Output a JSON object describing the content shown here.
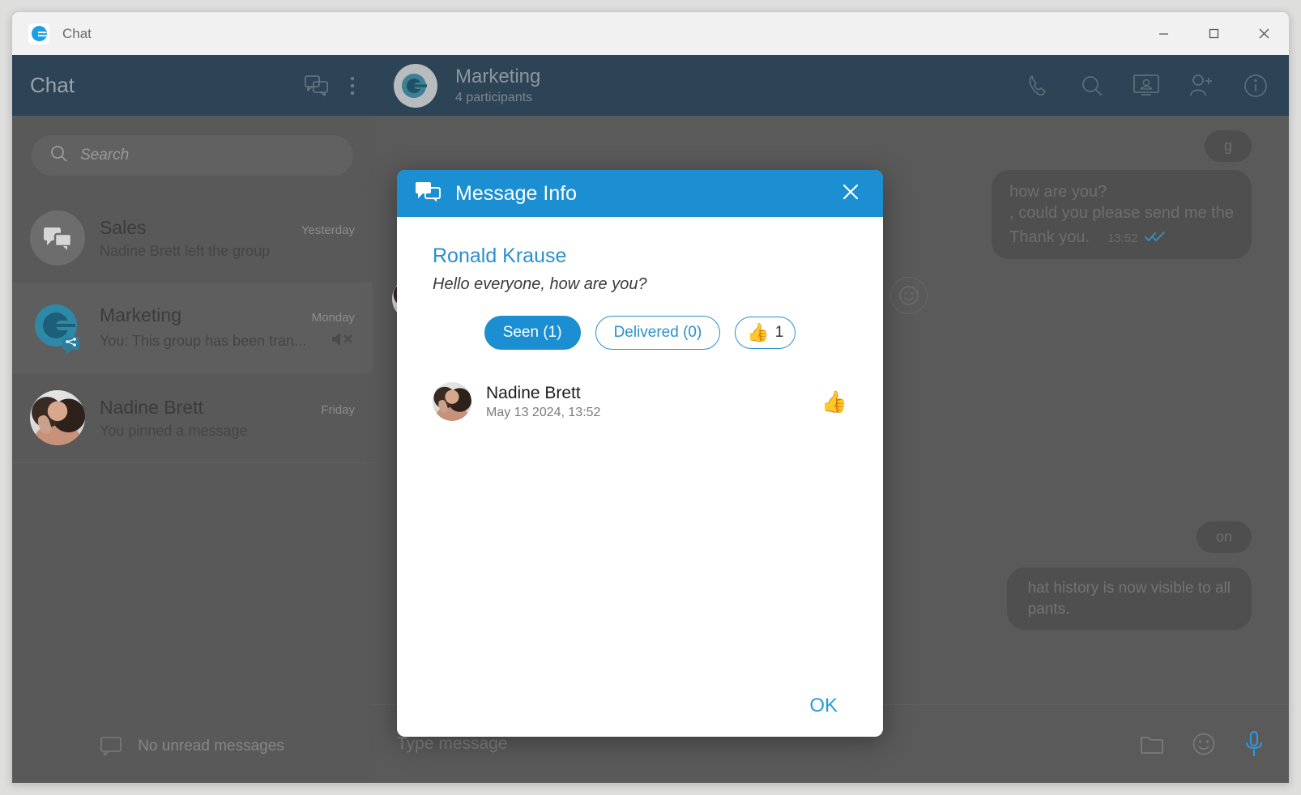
{
  "window": {
    "title": "Chat",
    "app_icon": "chat-app-logo-icon",
    "controls": {
      "minimize": "—",
      "maximize": "□",
      "close": "✕"
    }
  },
  "sidebar": {
    "title": "Chat",
    "new_chat_icon": "new-chat-icon",
    "menu_icon": "more-options-icon",
    "search": {
      "placeholder": "Search",
      "value": "",
      "icon": "search-icon"
    },
    "chats": [
      {
        "name": "Sales",
        "time": "Yesterday",
        "preview": "Nadine Brett left the group",
        "avatar": "group-chat-icon",
        "selected": false,
        "muted": false
      },
      {
        "name": "Marketing",
        "time": "Monday",
        "preview": "You: This group has been tran...",
        "avatar": "marketing-group-logo",
        "selected": true,
        "muted": true,
        "mute_icon": "muted-speaker-icon"
      },
      {
        "name": "Nadine Brett",
        "time": "Friday",
        "preview": "You pinned a message",
        "avatar": "nadine-brett-photo",
        "selected": false,
        "muted": false
      }
    ],
    "footer": {
      "label": "No unread messages",
      "icon": "speech-bubble-icon"
    }
  },
  "chat_header": {
    "title": "Marketing",
    "subtitle": "4 participants",
    "avatar": "marketing-group-logo",
    "actions": [
      {
        "name": "call-icon",
        "label": "Call"
      },
      {
        "name": "search-icon",
        "label": "Search"
      },
      {
        "name": "screen-share-icon",
        "label": "Screen share"
      },
      {
        "name": "add-participant-icon",
        "label": "Add participant"
      },
      {
        "name": "info-icon",
        "label": "Info"
      }
    ]
  },
  "conversation": {
    "messages": [
      {
        "type": "reaction-chip",
        "text": "g"
      },
      {
        "type": "outgoing",
        "text_lines": [
          "how are you?",
          ", could you please send me the",
          "Thank you."
        ],
        "time": "13:52",
        "status_icon": "double-check-icon"
      },
      {
        "type": "add-reaction",
        "icon": "smiley-icon"
      },
      {
        "type": "system",
        "text": "on"
      },
      {
        "type": "notice",
        "text_lines": [
          "hat history is now visible to all",
          "pants."
        ]
      }
    ]
  },
  "composer": {
    "placeholder": "Type message",
    "value": "",
    "actions": [
      {
        "name": "attach-file-icon",
        "label": "Attach file"
      },
      {
        "name": "emoji-icon",
        "label": "Emoji"
      },
      {
        "name": "microphone-icon",
        "label": "Voice message"
      }
    ]
  },
  "modal": {
    "title": "Message Info",
    "title_icon": "message-info-icon",
    "close_icon": "close-icon",
    "author": "Ronald Krause",
    "message_preview": "Hello everyone, how are you?",
    "tabs": [
      {
        "label": "Seen (1)",
        "active": true
      },
      {
        "label": "Delivered (0)",
        "active": false
      }
    ],
    "reaction_chip": {
      "emoji": "👍",
      "count": "1"
    },
    "recipients": [
      {
        "name": "Nadine Brett",
        "timestamp": "May 13 2024, 13:52",
        "reaction": "👍",
        "avatar": "nadine-brett-photo"
      }
    ],
    "ok_label": "OK"
  },
  "colors": {
    "accent": "#1b8fd1",
    "link": "#2a8fd0",
    "header_dark": "#2c4456",
    "sidebar_bg": "#595959",
    "main_bg": "#5a5a5a"
  }
}
